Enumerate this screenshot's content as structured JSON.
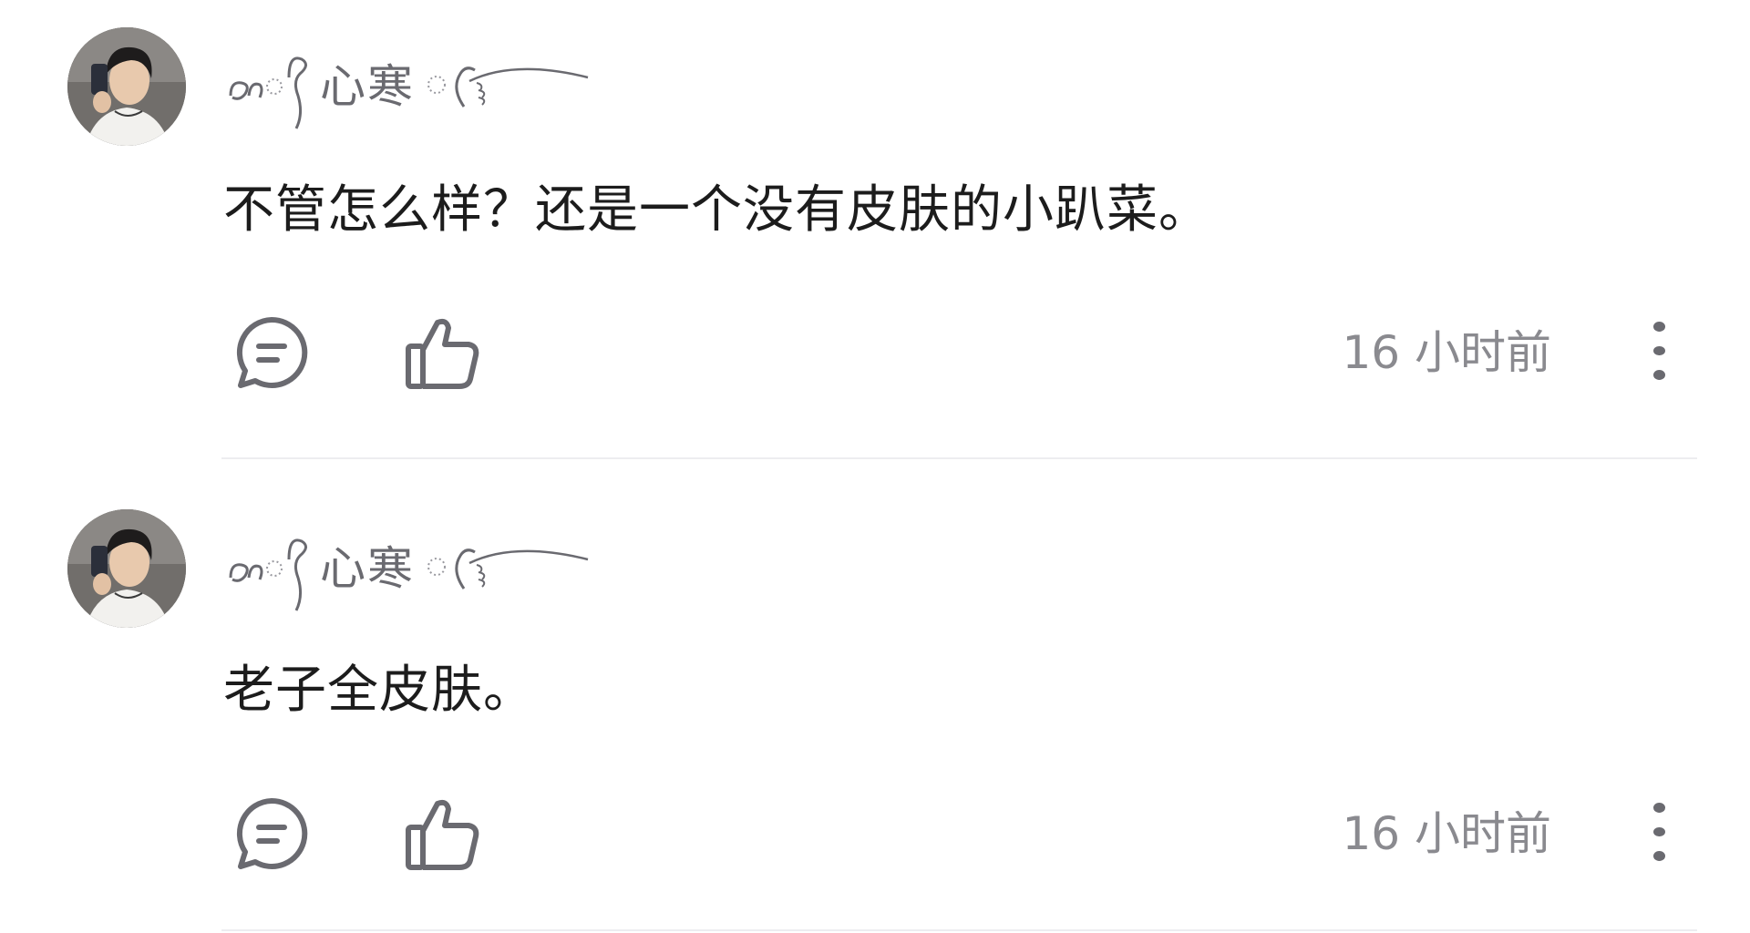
{
  "comments": [
    {
      "username": "心寒",
      "text": "不管怎么样？还是一个没有皮肤的小趴菜。",
      "timestamp": "16 小时前",
      "icons": {
        "avatar": "user-avatar-photo",
        "reply": "comment-bubble-icon",
        "like": "thumbs-up-icon",
        "more": "more-vertical-icon"
      }
    },
    {
      "username": "心寒",
      "text": "老子全皮肤。",
      "timestamp": "16 小时前",
      "icons": {
        "avatar": "user-avatar-photo",
        "reply": "comment-bubble-icon",
        "like": "thumbs-up-icon",
        "more": "more-vertical-icon"
      }
    }
  ],
  "colors": {
    "text": "#1c1c1c",
    "meta": "#8a8a8f",
    "icon": "#6a6a70",
    "divider": "#ededf0",
    "background": "#ffffff"
  }
}
